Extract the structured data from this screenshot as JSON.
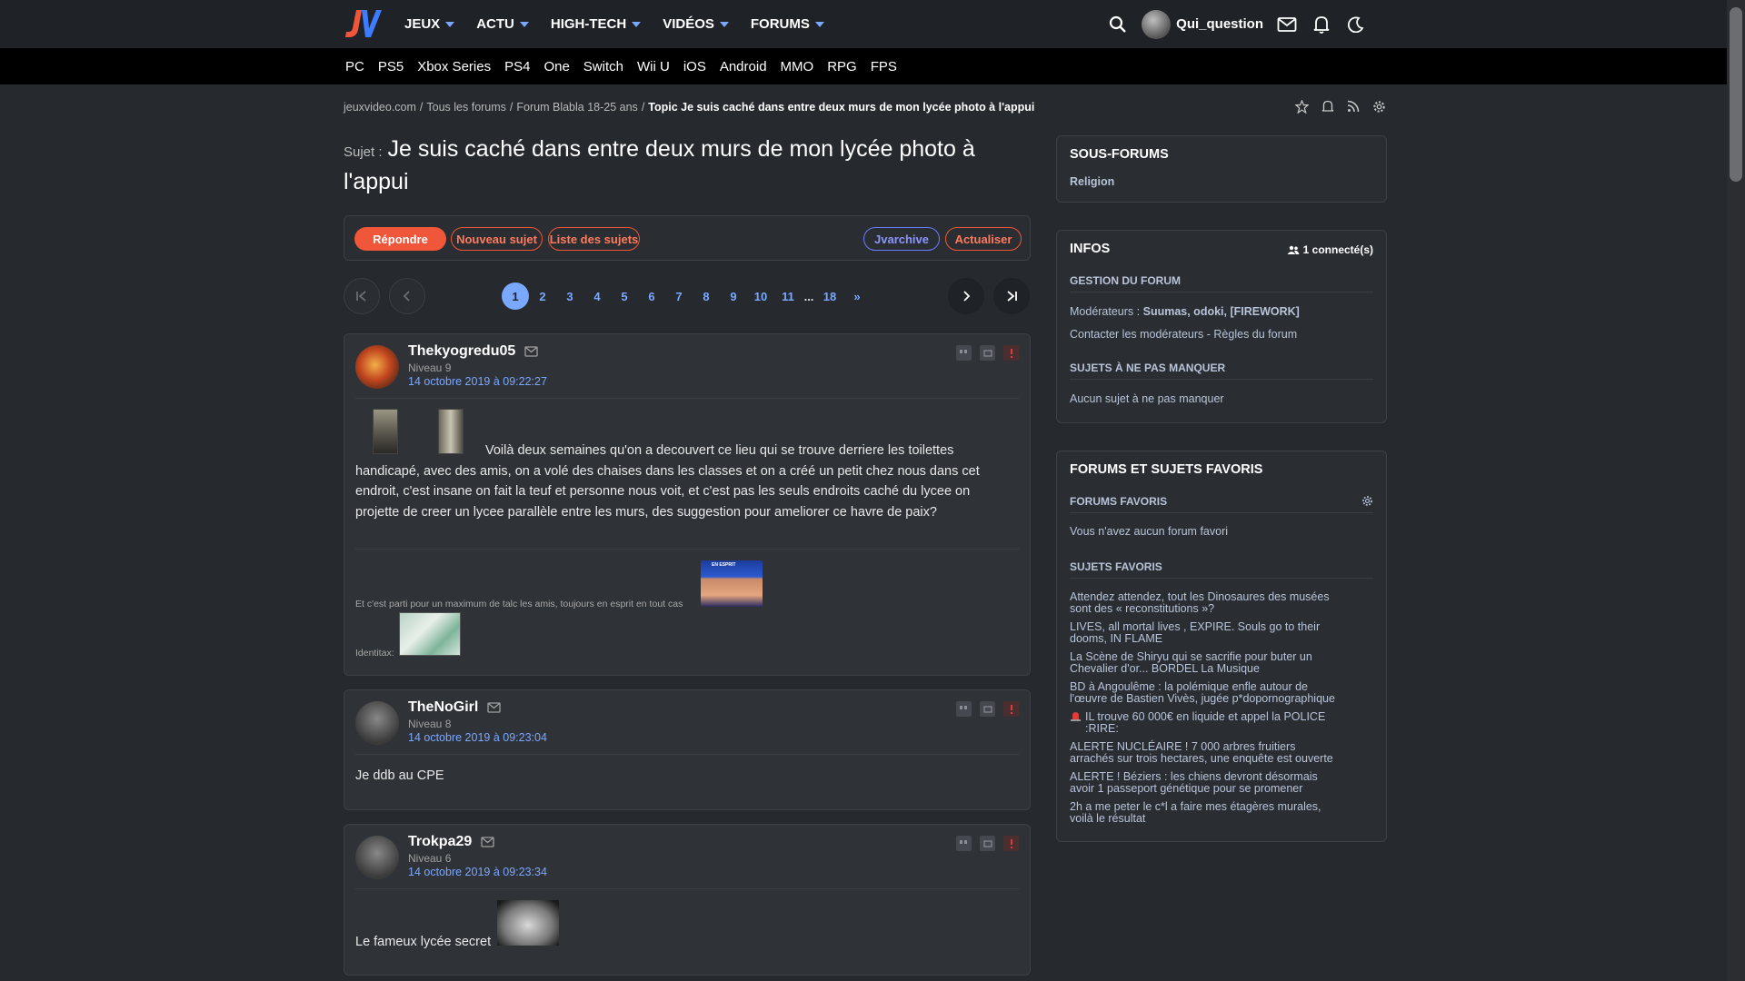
{
  "header": {
    "logo": "JV",
    "nav": [
      {
        "label": "JEUX"
      },
      {
        "label": "ACTU"
      },
      {
        "label": "HIGH-TECH"
      },
      {
        "label": "VIDÉOS"
      },
      {
        "label": "FORUMS"
      }
    ],
    "username": "Qui_question",
    "platforms": [
      "PC",
      "PS5",
      "Xbox Series",
      "PS4",
      "One",
      "Switch",
      "Wii U",
      "iOS",
      "Android",
      "MMO",
      "RPG",
      "FPS"
    ]
  },
  "breadcrumb": {
    "items": [
      "jeuxvideo.com",
      "/",
      "Tous les forums",
      "/",
      "Forum Blabla 18-25 ans",
      "/"
    ],
    "current": "Topic Je suis caché dans entre deux murs de mon lycée photo à l'appui"
  },
  "topic": {
    "label": "Sujet :",
    "title": "Je suis caché dans entre deux murs de mon lycée photo à l'appui"
  },
  "actions": {
    "reply": "Répondre",
    "new_topic": "Nouveau sujet",
    "topic_list": "Liste des sujets",
    "archive": "Jvarchive",
    "refresh": "Actualiser"
  },
  "pagination": {
    "pages": [
      "1",
      "2",
      "3",
      "4",
      "5",
      "6",
      "7",
      "8",
      "9",
      "10",
      "11",
      "...",
      "18",
      "»"
    ],
    "current": "1"
  },
  "posts": [
    {
      "author": "Thekyogredu05",
      "level": "Niveau 9",
      "date": "14 octobre 2019 à 09:22:27",
      "text_first": "Voilà deux semaines qu'on a decouvert ce lieu qui se trouve derriere les toilettes",
      "text_rest": "handicapé, avec des amis, on a volé des chaises dans les classes et on a créé un petit chez nous dans cet endroit, c'est insane on fait la teuf et personne nous voit, et c'est pas les seuls endroits caché du lycee on projette de creer un lycee parallèle entre les murs, des suggestion pour ameliorer ce havre de paix?",
      "signature": "Et c'est parti pour un maximum de talc les amis, toujours en esprit en tout cas",
      "signature2": "Identitax:",
      "sticker_text": "EN ESPRIT"
    },
    {
      "author": "TheNoGirl",
      "level": "Niveau 8",
      "date": "14 octobre 2019 à 09:23:04",
      "text": "Je ddb au CPE"
    },
    {
      "author": "Trokpa29",
      "level": "Niveau 6",
      "date": "14 octobre 2019 à 09:23:34",
      "text": "Le fameux lycée secret"
    }
  ],
  "sidebar": {
    "subforums": {
      "title": "SOUS-FORUMS",
      "items": [
        "Religion"
      ]
    },
    "infos": {
      "title": "INFOS",
      "connected": "1 connecté(s)",
      "management_title": "GESTION DU FORUM",
      "moderators_label": "Modérateurs :",
      "moderators": "Suumas, odoki, [FIREWORK]",
      "contact": "Contacter les modérateurs",
      "rules": "Règles du forum",
      "dash": " - ",
      "must_title": "SUJETS À NE PAS MANQUER",
      "must_text": "Aucun sujet à ne pas manquer"
    },
    "favorites": {
      "title": "FORUMS ET SUJETS FAVORIS",
      "forums_title": "FORUMS FAVORIS",
      "forums_empty": "Vous n'avez aucun forum favori",
      "topics_title": "SUJETS FAVORIS",
      "topics": [
        "Attendez attendez, tout les Dinosaures des musées sont des « reconstitutions »?",
        "LIVES, all mortal lives , EXPIRE. Souls go to their dooms, IN FLAME",
        "La Scène de Shiryu qui se sacrifie pour buter un Chevalier d'or... BORDEL La Musique",
        "BD à Angoulême : la polémique enfle autour de l'œuvre de Bastien Vivès, jugée p*dopornographique",
        "IL trouve 60 000€ en liquide et appel la POLICE :RIRE:",
        "ALERTE NUCLÉAIRE ! 7 000 arbres fruitiers arrachés sur trois hectares, une enquête est ouverte",
        "ALERTE ! Béziers : les chiens devront désormais avoir 1 passeport génétique pour se promener",
        "2h a me peter le c*l a faire mes étagères murales, voilà le résultat"
      ]
    }
  },
  "colors": {
    "accent": "#f0573a",
    "link": "#7aa8ff",
    "background": "#26292e",
    "card": "#2a2d32"
  }
}
